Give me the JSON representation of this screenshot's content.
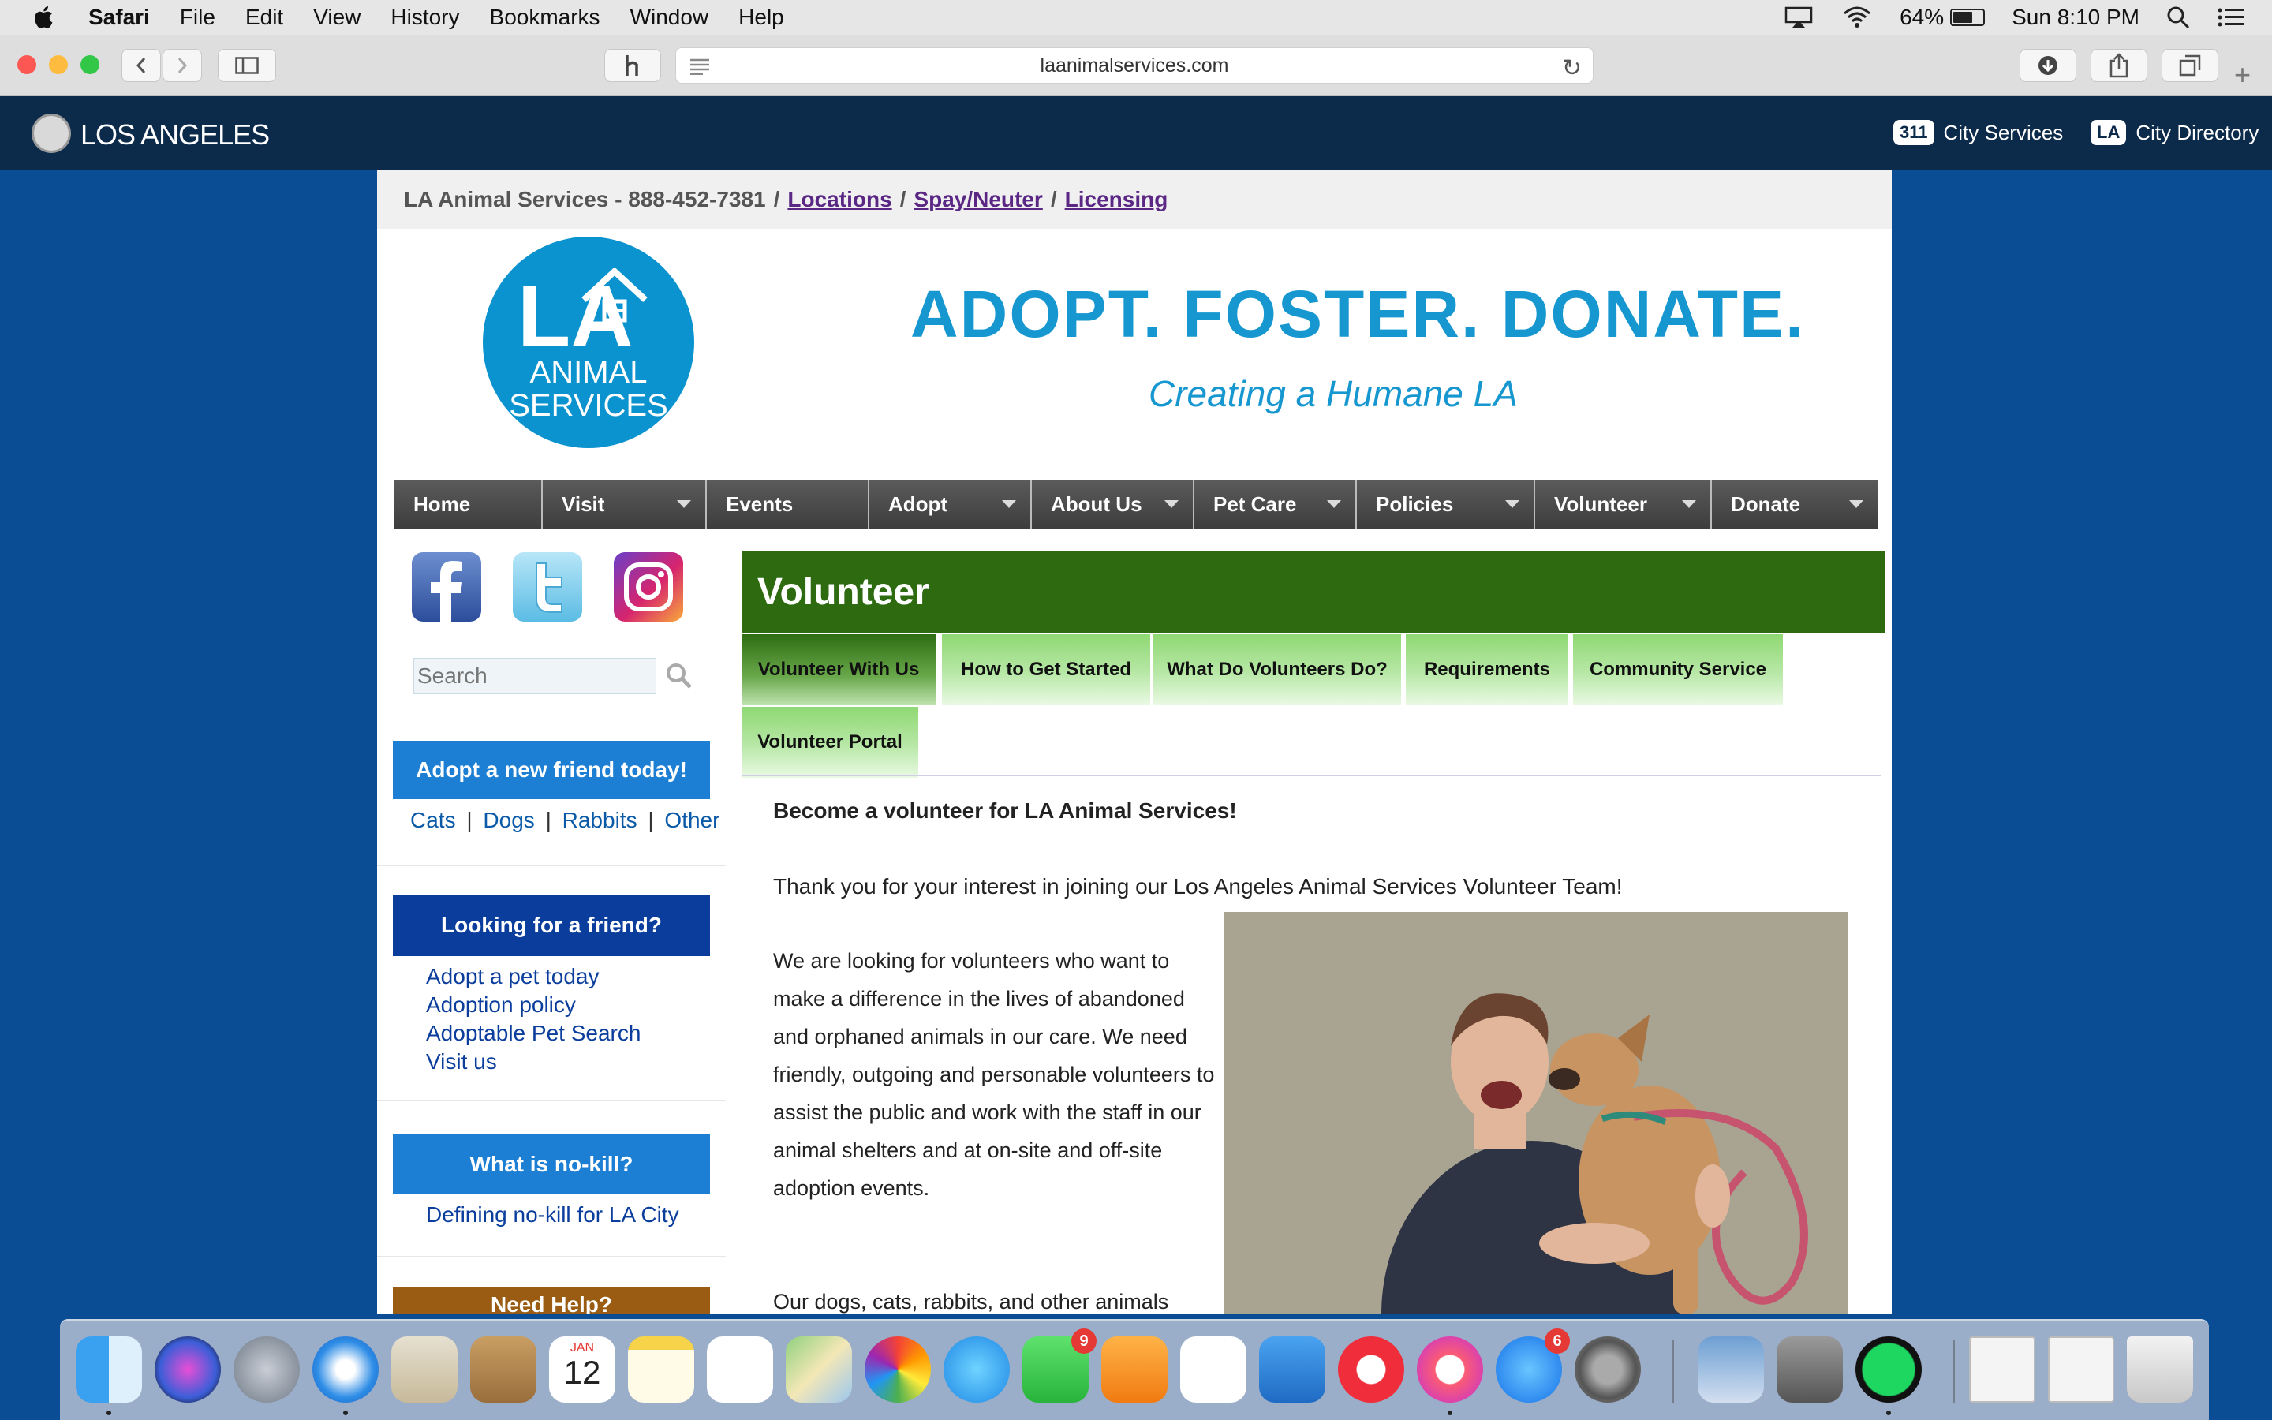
{
  "menubar": {
    "app": "Safari",
    "items": [
      "File",
      "Edit",
      "View",
      "History",
      "Bookmarks",
      "Window",
      "Help"
    ],
    "battery": "64%",
    "clock": "Sun 8:10 PM"
  },
  "browser": {
    "url": "laanimalservices.com"
  },
  "citybar": {
    "title": "LOS ANGELES",
    "links": [
      {
        "badge": "311",
        "label": "City Services"
      },
      {
        "badge": "LA",
        "label": "City Directory"
      }
    ]
  },
  "topline": {
    "text": "LA Animal Services - 888-452-7381",
    "sep": "/",
    "links": [
      "Locations",
      "Spay/Neuter",
      "Licensing"
    ]
  },
  "header": {
    "logo_line1": "ANIMAL",
    "logo_line2": "SERVICES",
    "logo_mark": "LA",
    "tagline": "ADOPT. FOSTER. DONATE.",
    "subtagline": "Creating a Humane LA"
  },
  "nav": [
    {
      "label": "Home",
      "dropdown": false
    },
    {
      "label": "Visit",
      "dropdown": true
    },
    {
      "label": "Events",
      "dropdown": false
    },
    {
      "label": "Adopt",
      "dropdown": true
    },
    {
      "label": "About Us",
      "dropdown": true
    },
    {
      "label": "Pet Care",
      "dropdown": true
    },
    {
      "label": "Policies",
      "dropdown": true
    },
    {
      "label": "Volunteer",
      "dropdown": true
    },
    {
      "label": "Donate",
      "dropdown": true
    }
  ],
  "sidebar": {
    "search_placeholder": "Search",
    "adopt_box": "Adopt a new friend today!",
    "adopt_links": [
      "Cats",
      "Dogs",
      "Rabbits",
      "Other"
    ],
    "adopt_sep": "|",
    "looking_box": "Looking for a friend?",
    "looking_links": [
      "Adopt a pet today",
      "Adoption policy",
      "Adoptable Pet Search",
      "Visit us"
    ],
    "nokill_box": "What is no-kill?",
    "nokill_link": "Defining no-kill for LA City",
    "partial_box": "Need Help?"
  },
  "content": {
    "title": "Volunteer",
    "tabs": [
      "Volunteer With Us",
      "How to Get Started",
      "What Do Volunteers Do?",
      "Requirements",
      "Community Service",
      "Volunteer Portal"
    ],
    "active_tab": "Volunteer With Us",
    "heading": "Become a volunteer for LA Animal Services!",
    "intro": "Thank you for your interest in joining our Los Angeles Animal Services Volunteer Team!",
    "para": "We are looking for volunteers who want to make a difference in the lives of abandoned and orphaned animals in our care. We need friendly, outgoing and personable volunteers to assist the public and work with the staff in our animal shelters and at on-site and off-site adoption events.",
    "para2": "Our dogs, cats, rabbits, and other animals"
  },
  "dock": {
    "apps": [
      "finder-icon",
      "siri-icon",
      "launchpad-icon",
      "safari-icon",
      "mail-icon",
      "contacts-icon",
      "calendar-icon",
      "notes-icon",
      "reminders-icon",
      "maps-icon",
      "photos-icon",
      "messages-icon",
      "facetime-icon",
      "pages-icon",
      "numbers-icon",
      "keynote-icon",
      "news-icon",
      "music-icon",
      "app-store-icon",
      "system-preferences-icon",
      "preview-icon",
      "calculator-icon",
      "spotify-icon",
      "window-thumb-icon",
      "window-thumb-icon",
      "trash-icon"
    ],
    "calendar_month": "JAN",
    "calendar_day": "12",
    "badges": {
      "facetime": "9",
      "app_store": "6"
    }
  },
  "colors": {
    "page_bg": "#0a4d94",
    "citybar": "#0c2a4a",
    "volunteer_green": "#2e6a10",
    "tab_green": "#b8e8a7",
    "sidebar_blue": "#1c7fd4",
    "sidebar_darkblue": "#0a3d9c",
    "brand_blue": "#1797d0"
  }
}
